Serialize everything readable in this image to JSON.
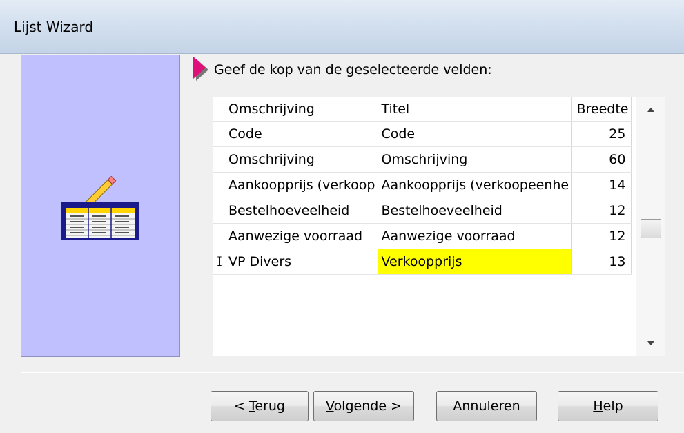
{
  "window": {
    "title": "Lijst Wizard"
  },
  "instruction": "Geef de kop van de geselecteerde velden:",
  "grid": {
    "columns": [
      "Omschrijving",
      "Titel",
      "Breedte"
    ],
    "rows": [
      {
        "omschrijving": "Code",
        "titel": "Code",
        "breedte": "25"
      },
      {
        "omschrijving": "Omschrijving",
        "titel": "Omschrijving",
        "breedte": "60"
      },
      {
        "omschrijving": "Aankoopprijs (verkoop",
        "titel": "Aankoopprijs (verkoopeenhe",
        "breedte": "14"
      },
      {
        "omschrijving": "Bestelhoeveelheid",
        "titel": "Bestelhoeveelheid",
        "breedte": "12"
      },
      {
        "omschrijving": "Aanwezige voorraad",
        "titel": "Aanwezige voorraad",
        "breedte": "12"
      },
      {
        "omschrijving": "VP Divers",
        "titel": "Verkoopprijs",
        "breedte": "13"
      }
    ],
    "active_row_marker": "I",
    "highlight_color": "#ffff00"
  },
  "buttons": {
    "back": {
      "prefix": "< ",
      "accel": "T",
      "rest": "erug"
    },
    "next": {
      "accel": "V",
      "rest": "olgende >"
    },
    "cancel": "Annuleren",
    "help": {
      "accel": "H",
      "rest": "elp"
    }
  },
  "colors": {
    "side_panel": "#c0c0ff",
    "pointer": "#e0107a"
  },
  "icons": {
    "wizard": "table-with-pencil-icon",
    "pointer": "pink-triangle-pointer-icon"
  }
}
